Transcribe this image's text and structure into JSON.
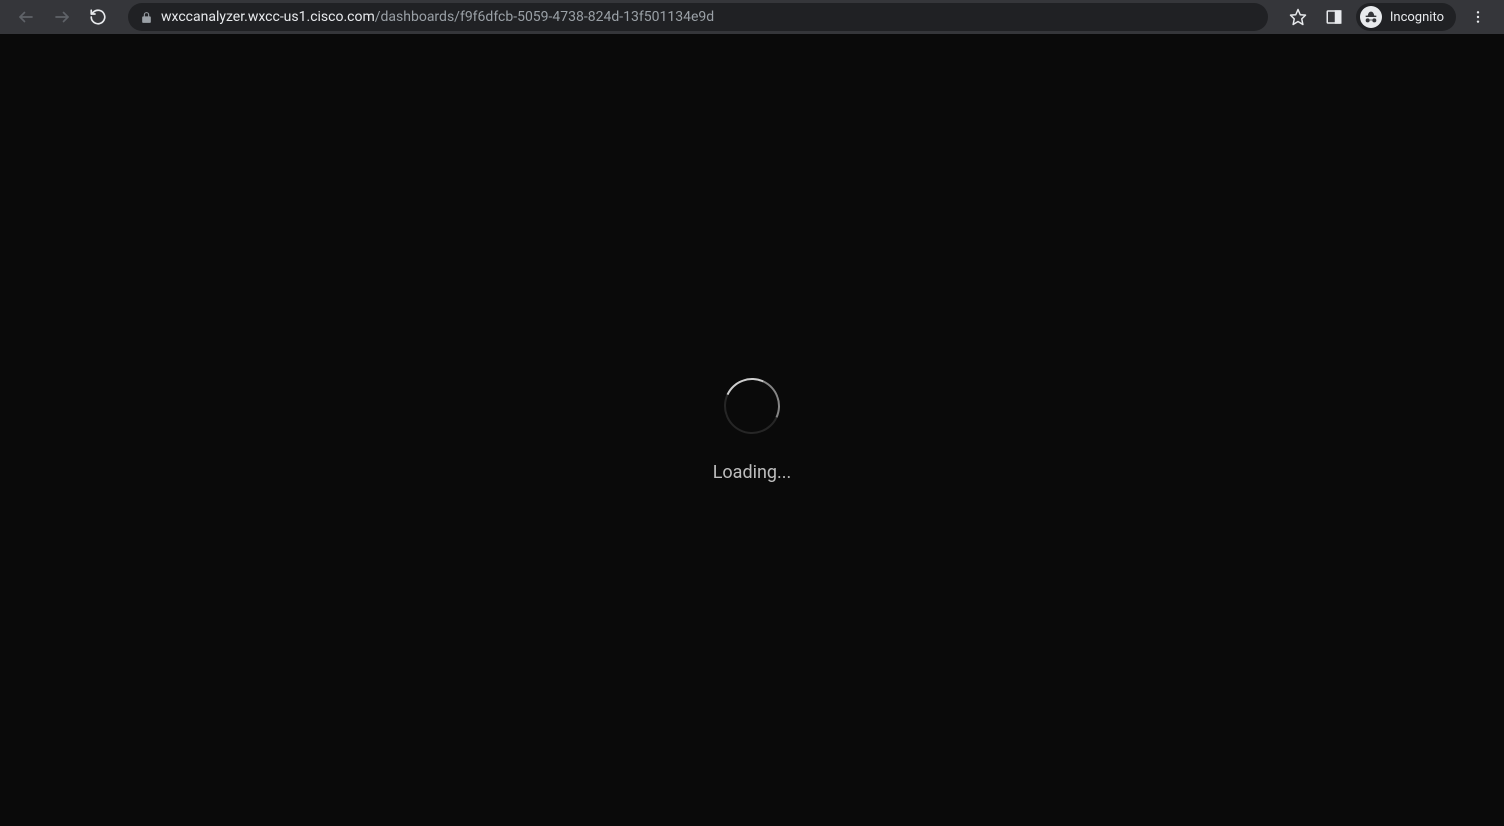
{
  "toolbar": {
    "url_domain": "wxccanalyzer.wxcc-us1.cisco.com",
    "url_path": "/dashboards/f9f6dfcb-5059-4738-824d-13f501134e9d",
    "incognito_label": "Incognito"
  },
  "page": {
    "loading_text": "Loading..."
  }
}
